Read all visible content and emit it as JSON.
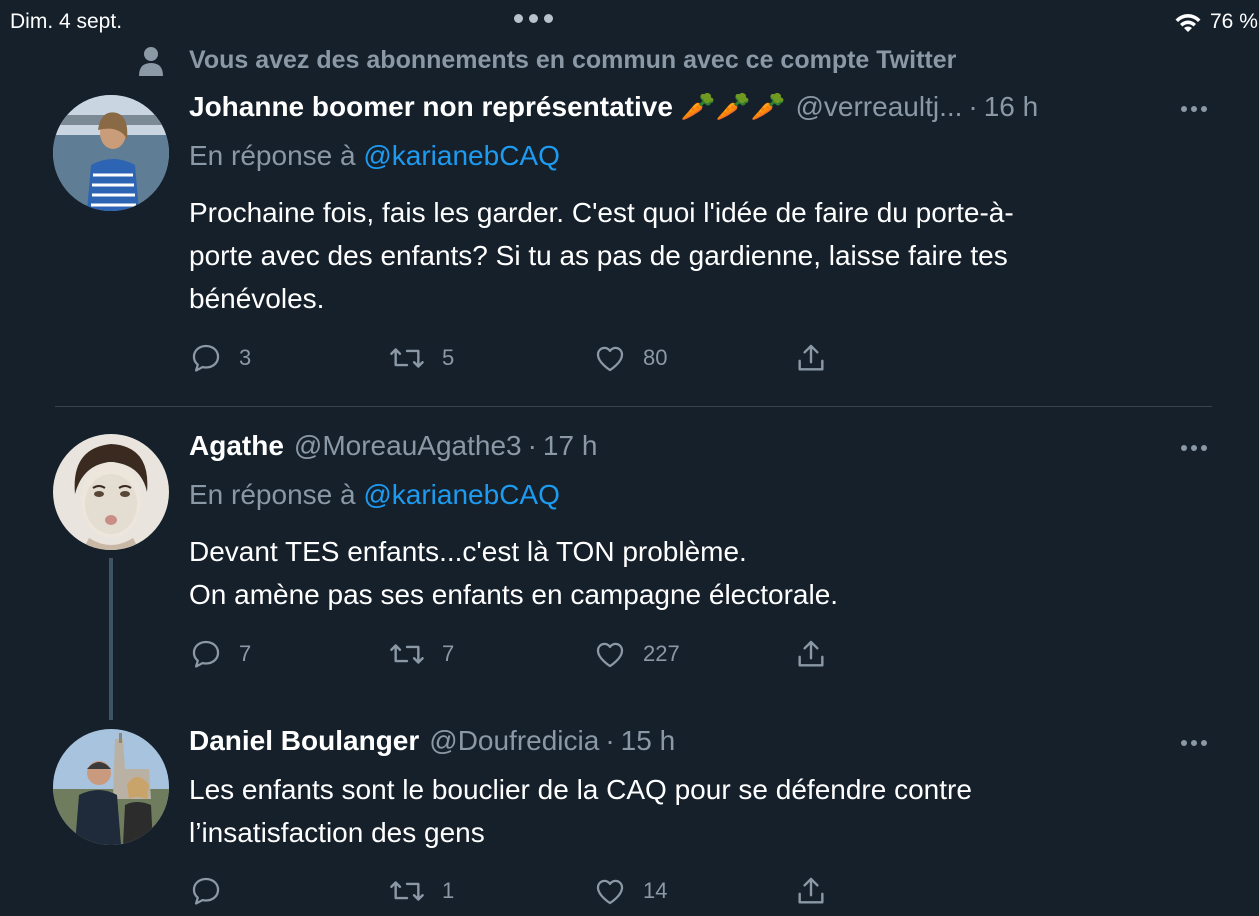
{
  "status_bar": {
    "time": "Dim. 4 sept.",
    "battery": "76 %"
  },
  "social_context": {
    "text": "Vous avez des abonnements en commun avec ce compte Twitter"
  },
  "tweets": [
    {
      "name": "Johanne boomer non représentative",
      "emoji": "🥕🥕🥕",
      "handle": "@verreaultj...",
      "separator": "·",
      "time": "16 h",
      "reply_prefix": "En réponse à",
      "reply_mention": "@karianebCAQ",
      "text_lines": [
        "Prochaine fois, fais les garder. C'est quoi l'idée de faire du porte-à-",
        "porte avec des enfants? Si tu as pas de gardienne, laisse faire tes",
        "bénévoles."
      ],
      "replies": "3",
      "retweets": "5",
      "likes": "80"
    },
    {
      "name": "Agathe",
      "handle": "@MoreauAgathe3",
      "separator": "·",
      "time": "17 h",
      "reply_prefix": "En réponse à",
      "reply_mention": "@karianebCAQ",
      "text_lines": [
        "Devant TES enfants...c'est là TON problème.",
        "On amène pas ses enfants en campagne électorale."
      ],
      "replies": "7",
      "retweets": "7",
      "likes": "227"
    },
    {
      "name": "Daniel Boulanger",
      "handle": "@Doufredicia",
      "separator": "·",
      "time": "15 h",
      "text_lines": [
        "Les enfants sont le bouclier de la CAQ pour se défendre contre",
        "l’insatisfaction des gens"
      ],
      "replies": "",
      "retweets": "1",
      "likes": "14"
    }
  ],
  "colors": {
    "background": "#15202b",
    "text": "#ffffff",
    "secondary": "#8b98a5",
    "link": "#1d9bf0",
    "divider": "#38444d"
  },
  "icons": [
    "wifi-icon",
    "person-icon",
    "more-icon",
    "reply-icon",
    "retweet-icon",
    "like-icon",
    "share-icon"
  ]
}
